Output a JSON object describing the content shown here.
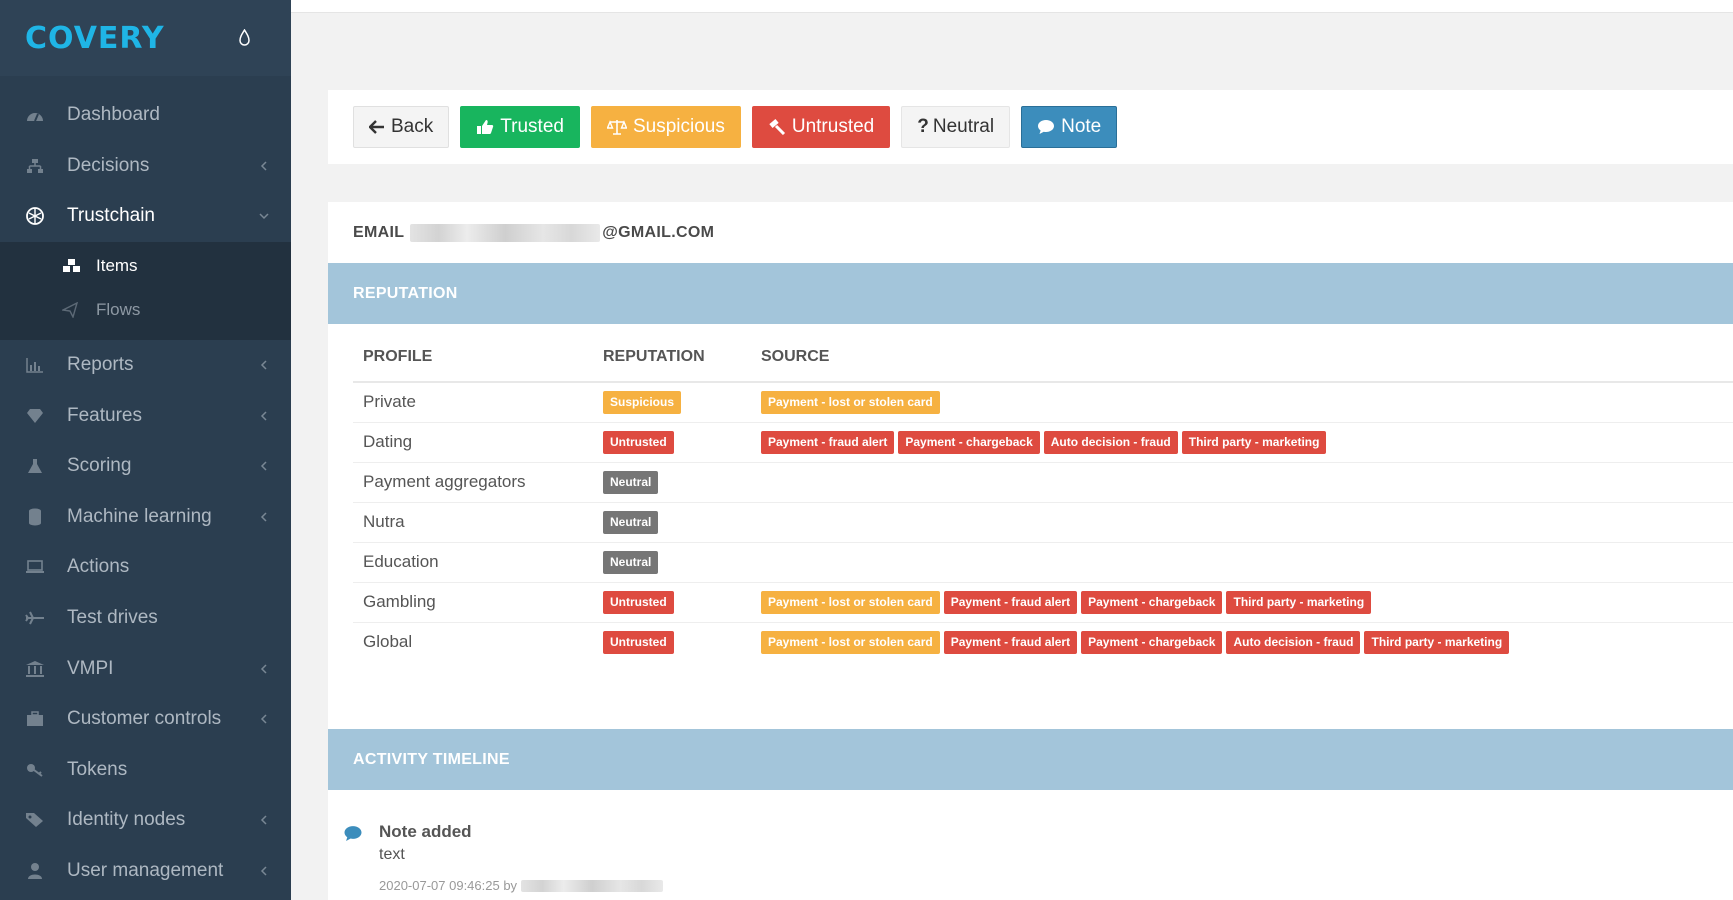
{
  "brand": {
    "logo": "COVERY"
  },
  "sidebar": {
    "items": [
      {
        "label": "Dashboard",
        "icon": "dashboard-icon"
      },
      {
        "label": "Decisions",
        "icon": "sitemap-icon"
      },
      {
        "label": "Trustchain",
        "icon": "chain-icon"
      },
      {
        "label": "Reports",
        "icon": "bar-chart-icon"
      },
      {
        "label": "Features",
        "icon": "diamond-icon"
      },
      {
        "label": "Scoring",
        "icon": "flask-icon"
      },
      {
        "label": "Machine learning",
        "icon": "database-icon"
      },
      {
        "label": "Actions",
        "icon": "laptop-icon"
      },
      {
        "label": "Test drives",
        "icon": "plane-icon"
      },
      {
        "label": "VMPI",
        "icon": "bank-icon"
      },
      {
        "label": "Customer controls",
        "icon": "briefcase-icon"
      },
      {
        "label": "Tokens",
        "icon": "key-icon"
      },
      {
        "label": "Identity nodes",
        "icon": "tags-icon"
      },
      {
        "label": "User management",
        "icon": "user-icon"
      }
    ],
    "trustchain_sub": [
      {
        "label": "Items",
        "icon": "cubes-icon"
      },
      {
        "label": "Flows",
        "icon": "paper-plane-icon"
      }
    ]
  },
  "toolbar": {
    "back": "Back",
    "trusted": "Trusted",
    "suspicious": "Suspicious",
    "untrusted": "Untrusted",
    "neutral": "Neutral",
    "note": "Note"
  },
  "email": {
    "label": "EMAIL",
    "domain": "@GMAIL.COM"
  },
  "reputation": {
    "title": "REPUTATION",
    "headers": {
      "profile": "PROFILE",
      "reputation": "REPUTATION",
      "source": "SOURCE"
    },
    "rows": [
      {
        "profile": "Private",
        "reputation": {
          "text": "Suspicious",
          "style": "warn"
        },
        "sources": [
          {
            "text": "Payment - lost or stolen card",
            "style": "warn"
          }
        ]
      },
      {
        "profile": "Dating",
        "reputation": {
          "text": "Untrusted",
          "style": "danger"
        },
        "sources": [
          {
            "text": "Payment - fraud alert",
            "style": "danger"
          },
          {
            "text": "Payment - chargeback",
            "style": "danger"
          },
          {
            "text": "Auto decision - fraud",
            "style": "danger"
          },
          {
            "text": "Third party - marketing",
            "style": "danger"
          }
        ]
      },
      {
        "profile": "Payment aggregators",
        "reputation": {
          "text": "Neutral",
          "style": "default"
        },
        "sources": []
      },
      {
        "profile": "Nutra",
        "reputation": {
          "text": "Neutral",
          "style": "default"
        },
        "sources": []
      },
      {
        "profile": "Education",
        "reputation": {
          "text": "Neutral",
          "style": "default"
        },
        "sources": []
      },
      {
        "profile": "Gambling",
        "reputation": {
          "text": "Untrusted",
          "style": "danger"
        },
        "sources": [
          {
            "text": "Payment - lost or stolen card",
            "style": "warn"
          },
          {
            "text": "Payment - fraud alert",
            "style": "danger"
          },
          {
            "text": "Payment - chargeback",
            "style": "danger"
          },
          {
            "text": "Third party - marketing",
            "style": "danger"
          }
        ]
      },
      {
        "profile": "Global",
        "reputation": {
          "text": "Untrusted",
          "style": "danger"
        },
        "sources": [
          {
            "text": "Payment - lost or stolen card",
            "style": "warn"
          },
          {
            "text": "Payment - fraud alert",
            "style": "danger"
          },
          {
            "text": "Payment - chargeback",
            "style": "danger"
          },
          {
            "text": "Auto decision - fraud",
            "style": "danger"
          },
          {
            "text": "Third party - marketing",
            "style": "danger"
          }
        ]
      }
    ]
  },
  "timeline": {
    "title": "ACTIVITY TIMELINE",
    "entries": [
      {
        "title": "Note added",
        "body": "text",
        "meta": "2020-07-07 09:46:25 by"
      }
    ]
  },
  "colors": {
    "sidebar": "#2b3e50",
    "accent": "#1fb5e6",
    "success": "#18b55e",
    "warning": "#f6b141",
    "danger": "#de4b40",
    "info": "#3c8dbc",
    "section": "#a3c5da"
  }
}
